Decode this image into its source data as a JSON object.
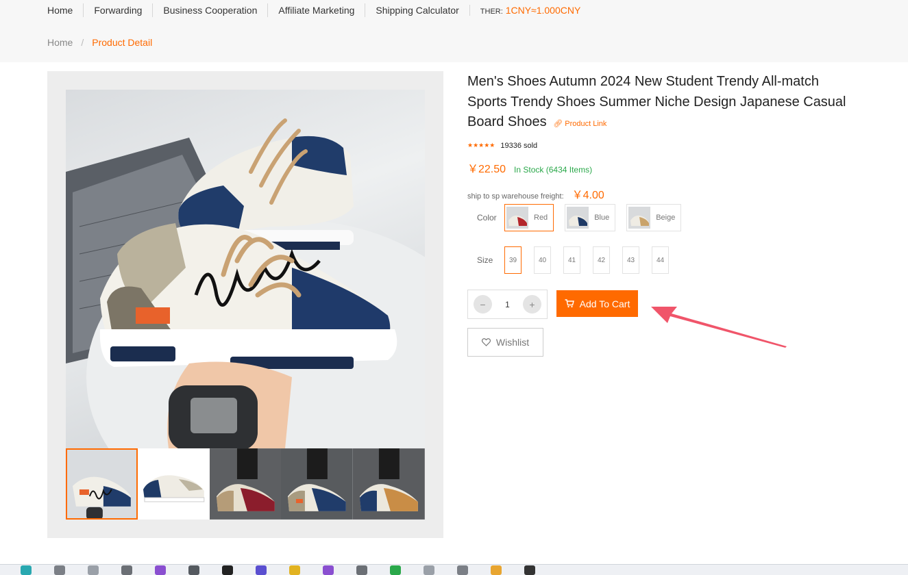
{
  "nav": {
    "items": [
      "Home",
      "Forwarding",
      "Business Cooperation",
      "Affiliate Marketing",
      "Shipping Calculator"
    ],
    "rate_label": "THER:",
    "rate_value": "1CNY≈1.000CNY"
  },
  "breadcrumb": {
    "home": "Home",
    "separator": "/",
    "current": "Product Detail"
  },
  "product": {
    "title": "Men's Shoes Autumn 2024 New Student Trendy All-match Sports Trendy Shoes Summer Niche Design Japanese Casual Board Shoes",
    "link_label": "Product Link",
    "rating": 4.5,
    "sold": "19336 sold",
    "price": "￥22.50",
    "stock": "In Stock (6434 Items)",
    "freight_label": "ship to sp warehouse freight:",
    "freight_value": "￥4.00"
  },
  "options": {
    "color_label": "Color",
    "colors": [
      {
        "label": "Red",
        "selected": true,
        "accent": "#b3262c"
      },
      {
        "label": "Blue",
        "selected": false,
        "accent": "#1f3a66"
      },
      {
        "label": "Beige",
        "selected": false,
        "accent": "#c9a36b"
      }
    ],
    "size_label": "Size",
    "sizes": [
      {
        "label": "39",
        "selected": true
      },
      {
        "label": "40",
        "selected": false
      },
      {
        "label": "41",
        "selected": false
      },
      {
        "label": "42",
        "selected": false
      },
      {
        "label": "43",
        "selected": false
      },
      {
        "label": "44",
        "selected": false
      }
    ]
  },
  "cart": {
    "minus": "−",
    "quantity": "1",
    "plus": "+",
    "add_to_cart": "Add To Cart",
    "wishlist": "Wishlist"
  },
  "colors": {
    "accent": "#ff6a00",
    "in_stock": "#2aa84a",
    "annotation_arrow": "#f0556a"
  }
}
